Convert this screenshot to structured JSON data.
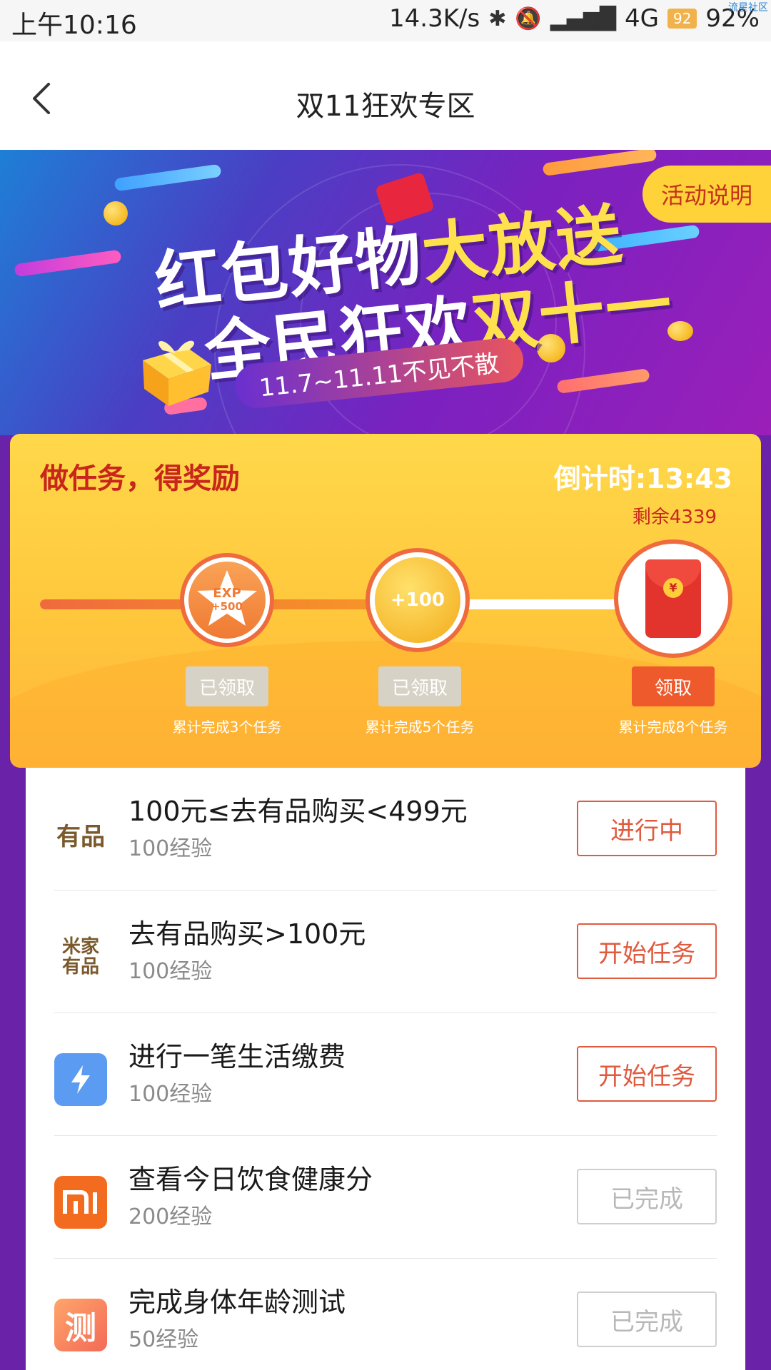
{
  "status_bar": {
    "time": "上午10:16",
    "speed": "14.3K/s",
    "network": "4G",
    "battery_badge": "92",
    "battery_percent": "92%",
    "watermark": "流星社区"
  },
  "header": {
    "title": "双11狂欢专区"
  },
  "banner": {
    "line1_white": "红包好物",
    "line1_yellow": "大放送",
    "line2_white": "全民狂欢",
    "line2_yellow": "双十一",
    "date_text": "11.7~11.11不见不散",
    "explain_button": "活动说明"
  },
  "rewards": {
    "title": "做任务，得奖励",
    "countdown": "倒计时:13:43",
    "remaining": "剩余4339",
    "progress_fraction": 0.56,
    "milestones": [
      {
        "badge_line1": "EXP",
        "badge_line2": "+500",
        "button": "已领取",
        "state": "done",
        "caption": "累计完成3个任务"
      },
      {
        "badge_line1": "+100",
        "badge_line2": "",
        "button": "已领取",
        "state": "done",
        "caption": "累计完成5个任务"
      },
      {
        "badge_line1": "¥",
        "badge_line2": "",
        "button": "领取",
        "state": "active",
        "caption": "累计完成8个任务"
      }
    ]
  },
  "tasks": [
    {
      "logo": "有品",
      "logo_style": "text",
      "title": "100元≤去有品购买<499元",
      "exp": "100经验",
      "button": "进行中",
      "button_style": "red"
    },
    {
      "logo": "米家\n有品",
      "logo_style": "text-small",
      "title": "去有品购买>100元",
      "exp": "100经验",
      "button": "开始任务",
      "button_style": "red"
    },
    {
      "logo": "lightning-icon",
      "logo_style": "blue",
      "title": "进行一笔生活缴费",
      "exp": "100经验",
      "button": "开始任务",
      "button_style": "red"
    },
    {
      "logo": "mi-icon",
      "logo_style": "orange",
      "title": "查看今日饮食健康分",
      "exp": "200经验",
      "button": "已完成",
      "button_style": "gray"
    },
    {
      "logo": "测",
      "logo_style": "coral",
      "title": "完成身体年龄测试",
      "exp": "50经验",
      "button": "已完成",
      "button_style": "gray"
    }
  ],
  "colors": {
    "accent_red": "#e05a3e",
    "reward_yellow": "#ffc73c",
    "purple_bg": "#6a23a8"
  }
}
